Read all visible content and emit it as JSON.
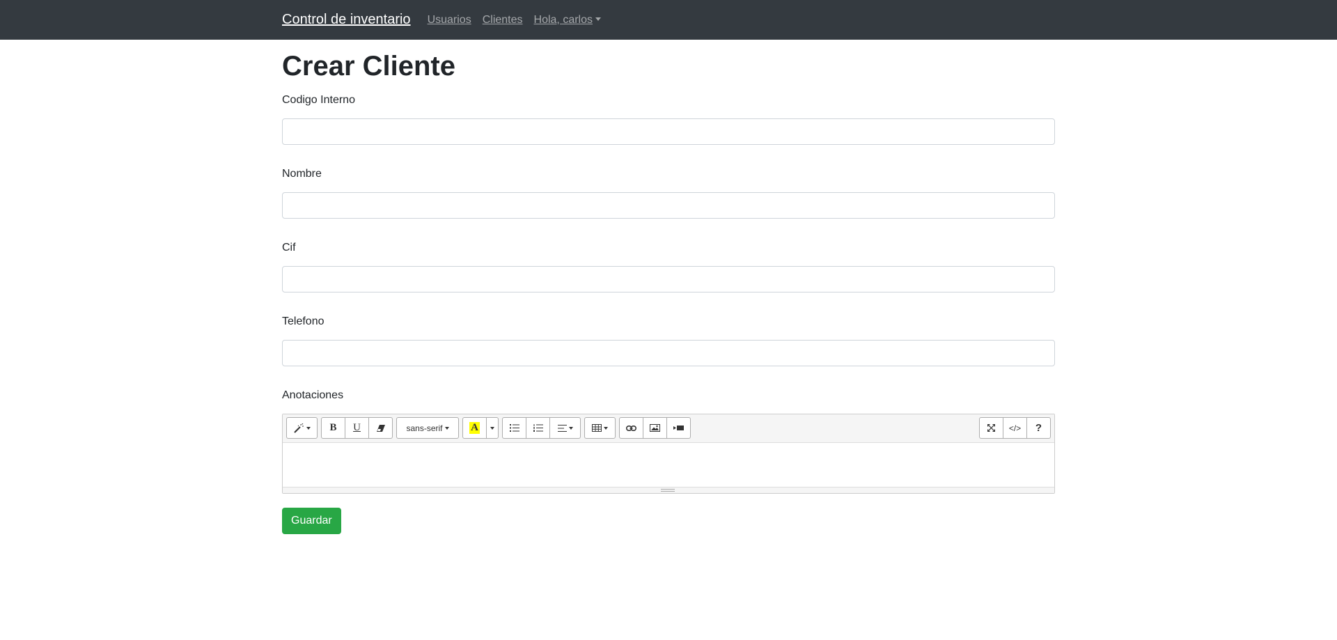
{
  "navbar": {
    "brand": "Control de inventario",
    "links": [
      "Usuarios",
      "Clientes"
    ],
    "user_menu": "Hola, carlos"
  },
  "page": {
    "title": "Crear Cliente"
  },
  "form": {
    "fields": [
      {
        "label": "Codigo Interno",
        "value": ""
      },
      {
        "label": "Nombre",
        "value": ""
      },
      {
        "label": "Cif",
        "value": ""
      },
      {
        "label": "Telefono",
        "value": ""
      }
    ],
    "notes_label": "Anotaciones",
    "editor": {
      "font_name": "sans-serif",
      "bold": "B",
      "underline": "U",
      "code_view": "</>",
      "help": "?",
      "content": ""
    },
    "submit_label": "Guardar"
  },
  "colors": {
    "navbar_bg": "#343a40",
    "success": "#28a745",
    "highlight": "#ffff00"
  }
}
